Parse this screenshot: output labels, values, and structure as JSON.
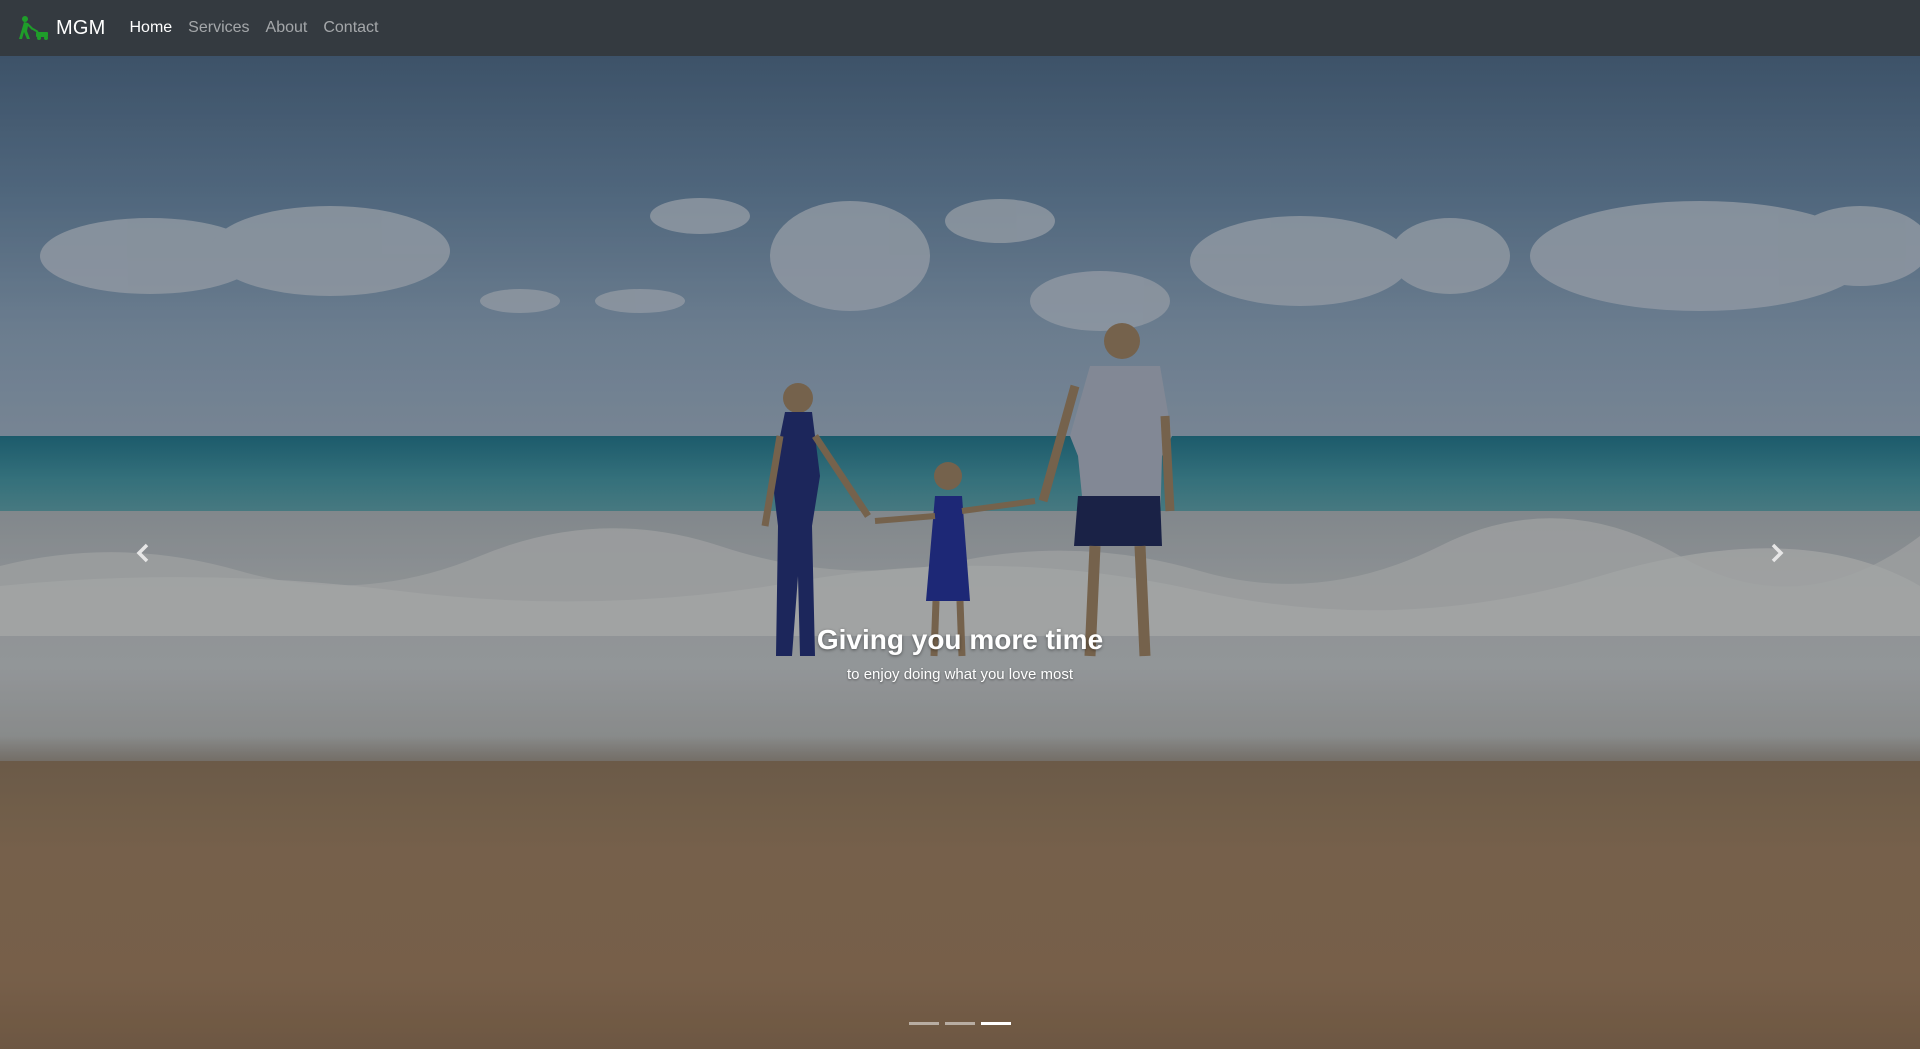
{
  "navbar": {
    "brand": "MGM",
    "brand_icon": "lawnmower-person-icon",
    "brand_icon_color": "#1f9d2a",
    "links": [
      {
        "label": "Home",
        "active": true
      },
      {
        "label": "Services",
        "active": false
      },
      {
        "label": "About",
        "active": false
      },
      {
        "label": "Contact",
        "active": false
      }
    ]
  },
  "carousel": {
    "caption_title": "Giving you more time",
    "caption_text": "to enjoy doing what you love most",
    "prev_icon": "chevron-left-icon",
    "next_icon": "chevron-right-icon",
    "slide_count": 3,
    "active_slide": 3
  },
  "colors": {
    "navbar_bg": "#343a40",
    "nav_active": "#ffffff",
    "nav_inactive": "rgba(255,255,255,0.55)"
  }
}
